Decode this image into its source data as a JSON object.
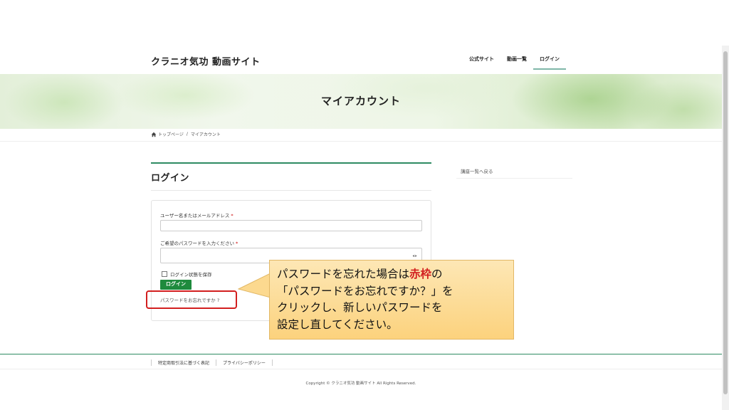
{
  "site": {
    "title": "クラニオ気功 動画サイト"
  },
  "nav": {
    "items": [
      {
        "label": "公式サイト"
      },
      {
        "label": "動画一覧"
      },
      {
        "label": "ログイン"
      }
    ]
  },
  "hero": {
    "title": "マイアカウント"
  },
  "breadcrumb": {
    "home": "トップページ",
    "separator": "/",
    "current": "マイアカウント"
  },
  "main": {
    "title": "ログイン"
  },
  "form": {
    "username_label": "ユーザー名またはメールアドレス",
    "password_label": "ご希望のパスワードを入力ください",
    "required_mark": "*",
    "remember_label": "ログイン状態を保存",
    "submit_label": "ログイン",
    "forgot_label": "パスワードをお忘れですか ?"
  },
  "callout": {
    "line1_prefix": "パスワードを忘れた場合は",
    "line1_emph": "赤枠",
    "line1_suffix": "の",
    "line2": "「パスワードをお忘れですか？」を",
    "line3": "クリックし、新しいパスワードを",
    "line4": "設定し直してください。"
  },
  "sidebar": {
    "back_link": "講座一覧へ戻る"
  },
  "footer": {
    "links": [
      {
        "label": "特定商取引法に基づく表記"
      },
      {
        "label": "プライバシーポリシー"
      }
    ],
    "copyright": "Copyright © クラニオ気功 動画サイト All Rights Reserved."
  },
  "colors": {
    "accent": "#2e8b62",
    "button": "#1e8a3d",
    "highlight_frame": "#d21f1f",
    "callout_bg": "#fcd27d"
  }
}
